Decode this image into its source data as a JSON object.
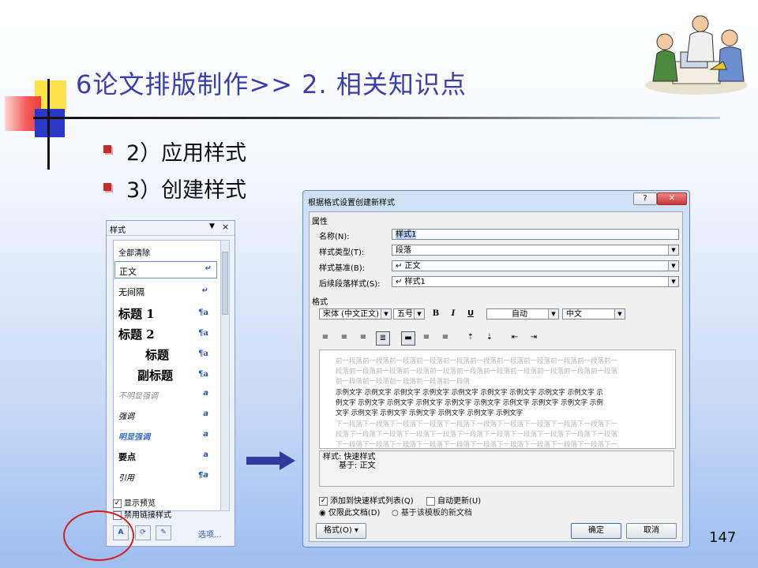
{
  "slide": {
    "title": "6论文排版制作>> 2. 相关知识点",
    "bullets": [
      "2）应用样式",
      "3）创建样式"
    ],
    "page_number": "147"
  },
  "styles_pane": {
    "title": "样式",
    "items": [
      {
        "label": "全部清除",
        "mark": ""
      },
      {
        "label": "正文",
        "mark": "↵"
      },
      {
        "label": "无间隔",
        "mark": "↵"
      },
      {
        "label": "标题 1",
        "mark": "¶a"
      },
      {
        "label": "标题 2",
        "mark": "¶a"
      },
      {
        "label": "标题",
        "mark": "¶a"
      },
      {
        "label": "副标题",
        "mark": "¶a"
      },
      {
        "label": "不明显强调",
        "mark": "a"
      },
      {
        "label": "强调",
        "mark": "a"
      },
      {
        "label": "明显强调",
        "mark": "a"
      },
      {
        "label": "要点",
        "mark": "a"
      },
      {
        "label": "引用",
        "mark": "¶a"
      }
    ],
    "show_preview": "显示预览",
    "disable_linked": "禁用链接样式",
    "options_link": "选项..."
  },
  "dialog": {
    "title": "根据格式设置创建新样式",
    "section_properties": "属性",
    "name_label": "名称(N):",
    "name_value": "样式1",
    "type_label": "样式类型(T):",
    "type_value": "段落",
    "base_label": "样式基准(B):",
    "base_value": "↵ 正文",
    "next_label": "后续段落样式(S):",
    "next_value": "↵ 样式1",
    "section_format": "格式",
    "font_value": "宋体 (中文正文)",
    "size_value": "五号",
    "color_value": "自动",
    "lang_value": "中文",
    "bold": "B",
    "italic": "I",
    "underline": "U",
    "preview_prev": [
      "前一段落前一段落前一段落前一段落前一段落前一段落前一段落前一段落前一段落前一段落前一",
      "段落前一段落前一段落前一段落前一段落前一段落前一段落前一段落前一段落前一段落前一段落",
      "前一段落前一段落前一段落前一段落前一段落"
    ],
    "preview_sample": [
      "示例文字 示例文字 示例文字 示例文字 示例文字 示例文字 示例文字 示例文字 示例文字 示",
      "例文字 示例文字 示例文字 示例文字 示例文字 示例文字 示例文字 示例文字 示例文字 示例",
      "文字 示例文字 示例文字 示例文字 示例文字 示例文字 示例文字"
    ],
    "preview_next": [
      "下一段落下一段落下一段落下一段落下一段落下一段落下一段落下一段落下一段落下一段落下一",
      "段落下一段落下一段落下一段落下一段落下一段落下一段落下一段落下一段落下一段落下一段落",
      "下一段落下一段落下一段落下一段落下一段落下一段落下一段落下一段落下一段落下一段落下一"
    ],
    "desc_line1": "样式: 快速样式",
    "desc_line2": "基于: 正文",
    "add_quick": "添加到快速样式列表(Q)",
    "auto_update": "自动更新(U)",
    "only_doc": "仅限此文档(D)",
    "template_doc": "基于该模板的新文档",
    "format_button": "格式(O) ▾",
    "ok": "确定",
    "cancel": "取消",
    "help": "?",
    "close": "✕"
  }
}
